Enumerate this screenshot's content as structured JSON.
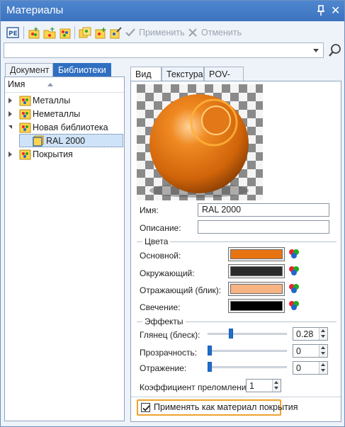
{
  "window": {
    "title": "Материалы"
  },
  "toolbar": {
    "apply_label": "Применить",
    "cancel_label": "Отменить"
  },
  "left": {
    "tabs": [
      "Документ",
      "Библиотеки"
    ],
    "column_header": "Имя",
    "tree": [
      {
        "label": "Металлы"
      },
      {
        "label": "Неметаллы"
      },
      {
        "label": "Новая библиотека"
      },
      {
        "label": "RAL 2000"
      },
      {
        "label": "Покрытия"
      }
    ]
  },
  "right": {
    "tabs": [
      "Вид",
      "Текстура",
      "POV-Ray"
    ],
    "name_label": "Имя:",
    "name_value": "RAL 2000",
    "description_label": "Описание:",
    "description_value": "",
    "colors_group": "Цвета",
    "colors": [
      {
        "label": "Основной:",
        "color": "#e87411"
      },
      {
        "label": "Окружающий:",
        "color": "#2b2b2b"
      },
      {
        "label": "Отражающий (блик):",
        "color": "#f7b482"
      },
      {
        "label": "Свечение:",
        "color": "#000000"
      }
    ],
    "effects_group": "Эффекты",
    "effects": [
      {
        "label": "Глянец (блеск):",
        "value": "0.28",
        "level": 0.28
      },
      {
        "label": "Прозрачность:",
        "value": "0",
        "level": 0
      },
      {
        "label": "Отражение:",
        "value": "0",
        "level": 0
      }
    ],
    "refraction_label": "Коэффициент преломления:",
    "refraction_value": "1",
    "apply_coating_label": "Применять как материал покрытия"
  }
}
